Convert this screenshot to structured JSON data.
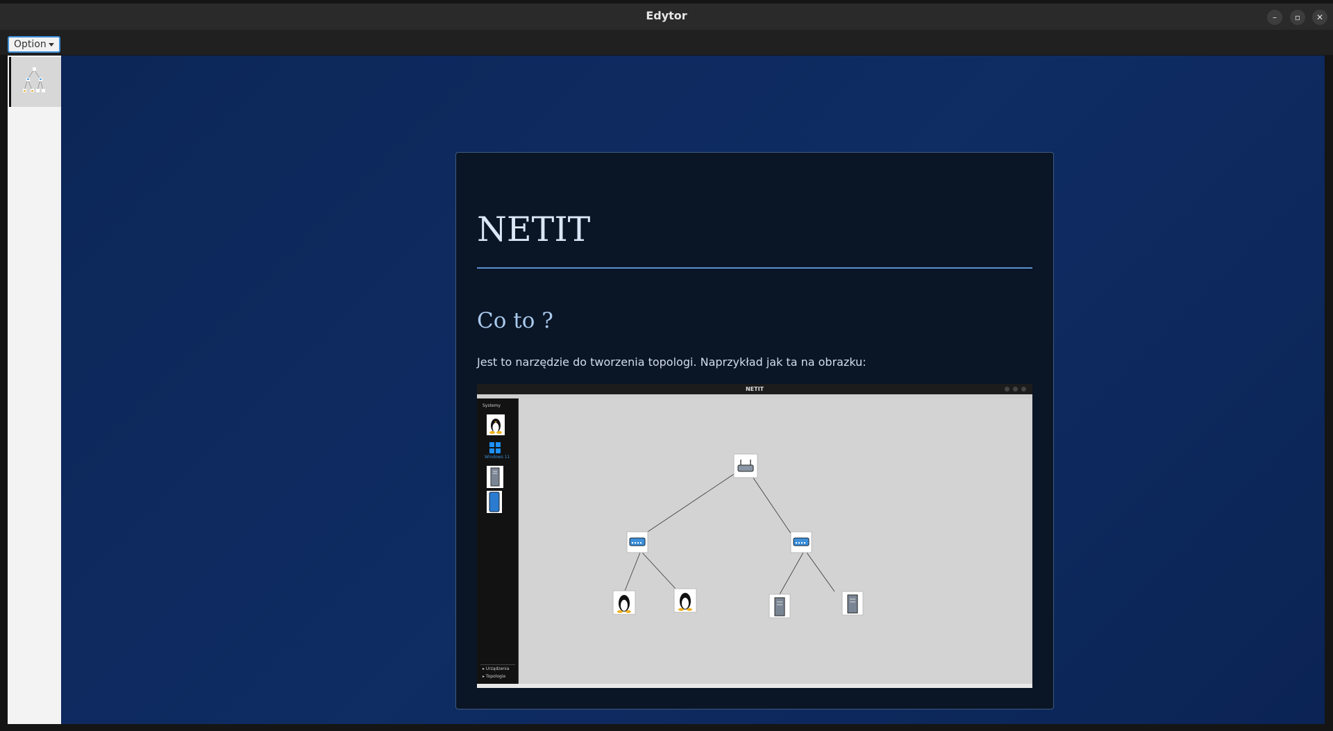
{
  "window": {
    "title": "Edytor"
  },
  "menu": {
    "option_label": "Option"
  },
  "document": {
    "title": "NETIT",
    "section_heading": "Co to ?",
    "paragraph": "Jest to narzędzie do tworzenia topologi. Naprzykład jak ta na obrazku:"
  },
  "embedded_screenshot": {
    "window_title": "NETIT",
    "sidebar_header": "Systemy",
    "sidebar_windows_label": "Windows 11",
    "sidebar_footer_devices": "Urządzenia",
    "sidebar_footer_topology": "Topologie",
    "nodes": [
      "router",
      "switch",
      "switch",
      "linux",
      "linux",
      "server",
      "server"
    ]
  },
  "colors": {
    "accent": "#3d8fd9",
    "card_bg": "#0a1526",
    "main_bg": "#0c2657",
    "rule": "#5a92d1"
  }
}
